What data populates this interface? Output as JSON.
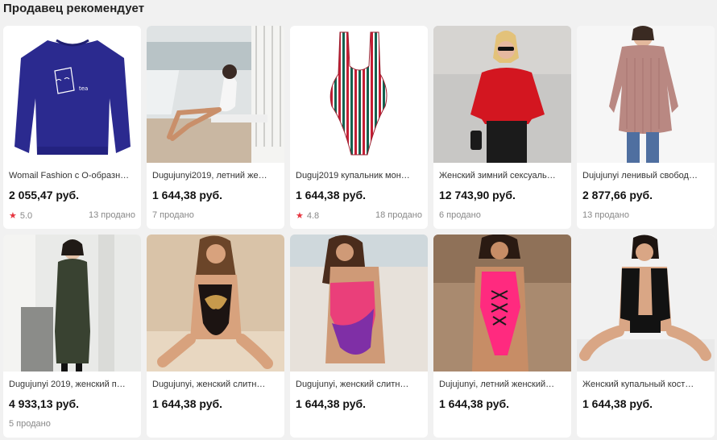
{
  "section_title": "Продавец рекомендует",
  "products": [
    {
      "name": "Womail Fashion с О-образн…",
      "price": "2 055,47 руб.",
      "rating": "5.0",
      "sold": "13 продано",
      "image": "sweatshirt-photo"
    },
    {
      "name": "Dugujunyi2019, летний же…",
      "price": "1 644,38 руб.",
      "rating": "",
      "sold": "7 продано",
      "image": "beach-swimsuit-photo"
    },
    {
      "name": "Duguj2019 купальник мон…",
      "price": "1 644,38 руб.",
      "rating": "4.8",
      "sold": "18 продано",
      "image": "striped-swimsuit-photo"
    },
    {
      "name": "Женский зимний сексуаль…",
      "price": "12 743,90 руб.",
      "rating": "",
      "sold": "6 продано",
      "image": "red-sweater-photo"
    },
    {
      "name": "Dujujunyi ленивый свобод…",
      "price": "2 877,66 руб.",
      "rating": "",
      "sold": "13 продано",
      "image": "pink-knit-sweater-photo"
    },
    {
      "name": "Dugujunyi 2019, женский п…",
      "price": "4 933,13 руб.",
      "rating": "",
      "sold": "5 продано",
      "image": "winter-coat-photo"
    },
    {
      "name": "Dugujunyi, женский слитн…",
      "price": "1 644,38 руб.",
      "rating": "",
      "sold": "",
      "image": "black-gold-swimsuit-photo"
    },
    {
      "name": "Dugujunyi, женский слитн…",
      "price": "1 644,38 руб.",
      "rating": "",
      "sold": "",
      "image": "pink-purple-swimsuit-photo"
    },
    {
      "name": "Dujujunyi, летний женский…",
      "price": "1 644,38 руб.",
      "rating": "",
      "sold": "",
      "image": "pink-lace-swimsuit-photo"
    },
    {
      "name": "Женский купальный кост…",
      "price": "1 644,38 руб.",
      "rating": "",
      "sold": "",
      "image": "black-cutout-swimsuit-photo"
    }
  ],
  "colors": {
    "star": "#e6343e",
    "background": "#f1f1f1"
  }
}
